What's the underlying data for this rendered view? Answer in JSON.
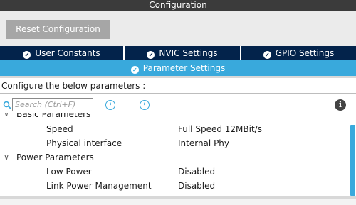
{
  "window": {
    "title": "Configuration"
  },
  "toolbar": {
    "reset_label": "Reset Configuration"
  },
  "tabs": [
    {
      "label": "User Constants"
    },
    {
      "label": "NVIC Settings"
    },
    {
      "label": "GPIO Settings"
    }
  ],
  "active_tab": {
    "label": "Parameter Settings"
  },
  "hint": "Configure the below parameters :",
  "search": {
    "placeholder": "Search (Ctrl+F)"
  },
  "tree": {
    "groups": [
      {
        "label": "Basic Parameters",
        "items": [
          {
            "name": "Speed",
            "value": "Full Speed 12MBit/s"
          },
          {
            "name": "Physical interface",
            "value": "Internal Phy"
          }
        ]
      },
      {
        "label": "Power Parameters",
        "items": [
          {
            "name": "Low Power",
            "value": "Disabled"
          },
          {
            "name": "Link Power Management",
            "value": "Disabled"
          }
        ]
      }
    ]
  },
  "colors": {
    "tab_dark": "#03234b",
    "tab_active": "#39a9dc",
    "title_bar": "#3b3b3b"
  }
}
